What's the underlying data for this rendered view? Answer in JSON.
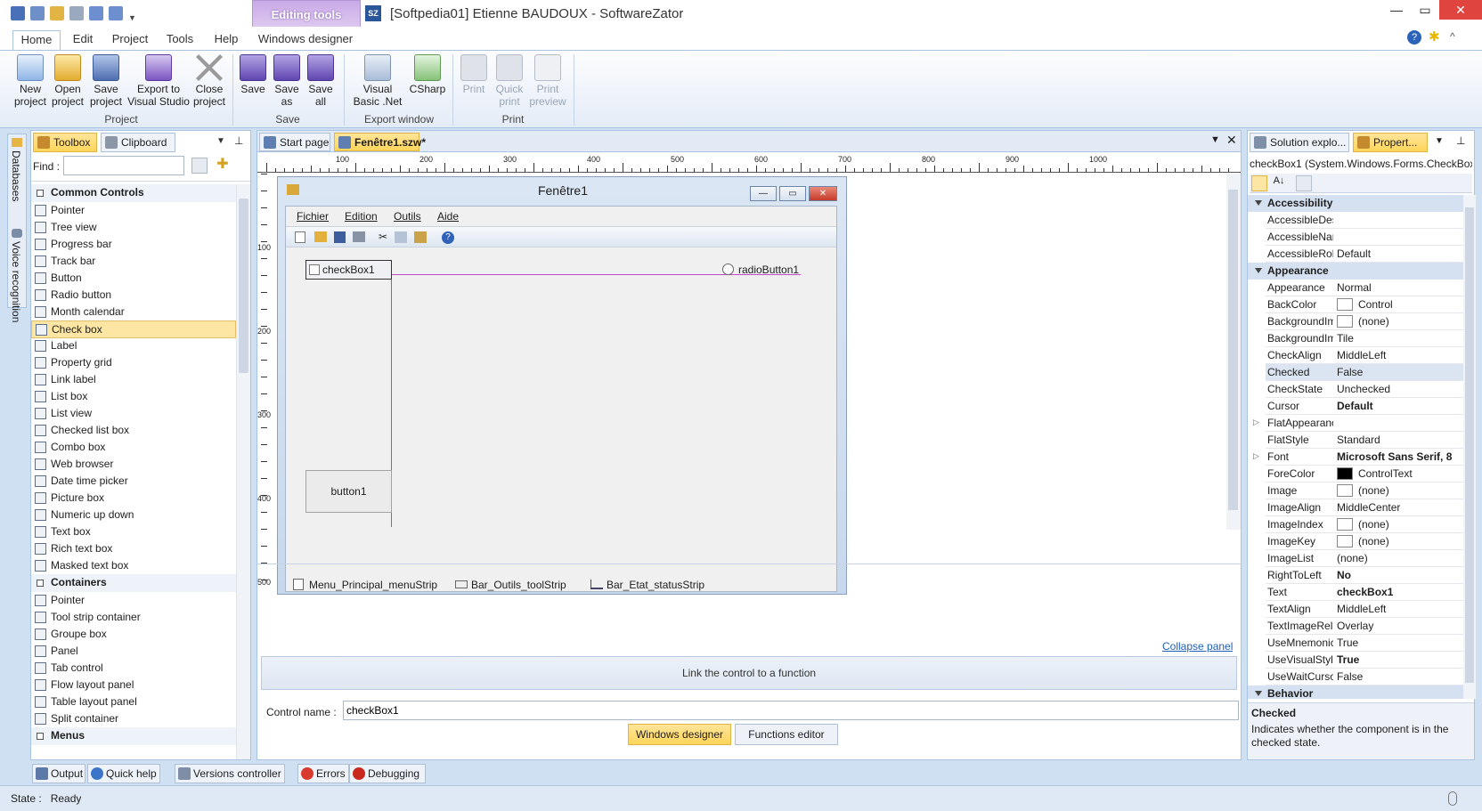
{
  "window": {
    "title": "[Softpedia01] Etienne BAUDOUX - SoftwareZator",
    "app_badge": "SZ",
    "context_tab": "Editing tools"
  },
  "menu_tabs": [
    "Home",
    "Edit",
    "Project",
    "Tools",
    "Help",
    "Windows designer"
  ],
  "ribbon": {
    "project": {
      "label": "Project",
      "buttons": [
        {
          "label": "New project"
        },
        {
          "label": "Open project"
        },
        {
          "label": "Save project"
        },
        {
          "label": "Export to Visual Studio"
        },
        {
          "label": "Close project"
        }
      ]
    },
    "save": {
      "label": "Save",
      "buttons": [
        {
          "label": "Save"
        },
        {
          "label": "Save as"
        },
        {
          "label": "Save all"
        }
      ]
    },
    "export": {
      "label": "Export window",
      "buttons": [
        {
          "label": "Visual Basic .Net"
        },
        {
          "label": "CSharp"
        }
      ]
    },
    "print": {
      "label": "Print",
      "buttons": [
        {
          "label": "Print"
        },
        {
          "label": "Quick print"
        },
        {
          "label": "Print preview"
        }
      ]
    }
  },
  "side_tabs": {
    "databases": "Databases",
    "voice": "Voice recognition"
  },
  "toolbox": {
    "tabs": [
      "Toolbox",
      "Clipboard"
    ],
    "find_label": "Find :",
    "find_value": "",
    "sections": [
      {
        "title": "Common Controls",
        "items": [
          "Pointer",
          "Tree view",
          "Progress bar",
          "Track bar",
          "Button",
          "Radio button",
          "Month calendar",
          "Check box",
          "Label",
          "Property grid",
          "Link label",
          "List box",
          "List view",
          "Checked list box",
          "Combo box",
          "Web browser",
          "Date time picker",
          "Picture box",
          "Numeric up down",
          "Text box",
          "Rich text box",
          "Masked text box"
        ]
      },
      {
        "title": "Containers",
        "items": [
          "Pointer",
          "Tool strip container",
          "Groupe box",
          "Panel",
          "Tab control",
          "Flow layout panel",
          "Table layout panel",
          "Split container"
        ]
      },
      {
        "title": "Menus",
        "items": []
      }
    ],
    "selected": "Check box"
  },
  "doc_tabs": [
    "Start page",
    "Fenêtre1.szw*"
  ],
  "ruler": {
    "h": [
      "100",
      "200",
      "300",
      "400",
      "500",
      "600",
      "700",
      "800",
      "900",
      "1000"
    ],
    "v": [
      "100",
      "200",
      "300",
      "400",
      "500"
    ]
  },
  "designed_form": {
    "title": "Fenêtre1",
    "menu": [
      "Fichier",
      "Edition",
      "Outils",
      "Aide"
    ],
    "checkbox": "checkBox1",
    "radio": "radioButton1",
    "button": "button1"
  },
  "components": [
    "Menu_Principal_menuStrip",
    "Bar_Outils_toolStrip",
    "Bar_Etat_statusStrip"
  ],
  "collapse_panel": "Collapse panel",
  "link_function": "Link the control to a function",
  "control_name_label": "Control name :",
  "control_name_value": "checkBox1",
  "designer_tabs": [
    "Windows designer",
    "Functions editor"
  ],
  "right_tabs": [
    "Solution explo...",
    "Propert..."
  ],
  "properties": {
    "object": "checkBox1 (System.Windows.Forms.CheckBox)",
    "rows": [
      {
        "cat": "Accessibility"
      },
      {
        "k": "AccessibleDescription",
        "v": ""
      },
      {
        "k": "AccessibleName",
        "v": ""
      },
      {
        "k": "AccessibleRole",
        "v": "Default"
      },
      {
        "cat": "Appearance"
      },
      {
        "k": "Appearance",
        "v": "Normal"
      },
      {
        "k": "BackColor",
        "v": "Control",
        "sw": "#ffffff"
      },
      {
        "k": "BackgroundImage",
        "v": "(none)",
        "sw": "#ffffff"
      },
      {
        "k": "BackgroundImageLayout",
        "v": "Tile"
      },
      {
        "k": "CheckAlign",
        "v": "MiddleLeft"
      },
      {
        "k": "Checked",
        "v": "False",
        "hl": true
      },
      {
        "k": "CheckState",
        "v": "Unchecked"
      },
      {
        "k": "Cursor",
        "v": "Default",
        "b": true
      },
      {
        "k": "FlatAppearance",
        "v": "",
        "exp": true
      },
      {
        "k": "FlatStyle",
        "v": "Standard"
      },
      {
        "k": "Font",
        "v": "Microsoft Sans Serif, 8",
        "b": true,
        "exp": true
      },
      {
        "k": "ForeColor",
        "v": "ControlText",
        "sw": "#000000"
      },
      {
        "k": "Image",
        "v": "(none)",
        "sw": "#ffffff"
      },
      {
        "k": "ImageAlign",
        "v": "MiddleCenter"
      },
      {
        "k": "ImageIndex",
        "v": "(none)",
        "sw": "#ffffff"
      },
      {
        "k": "ImageKey",
        "v": "(none)",
        "sw": "#ffffff"
      },
      {
        "k": "ImageList",
        "v": "(none)"
      },
      {
        "k": "RightToLeft",
        "v": "No",
        "b": true
      },
      {
        "k": "Text",
        "v": "checkBox1",
        "b": true
      },
      {
        "k": "TextAlign",
        "v": "MiddleLeft"
      },
      {
        "k": "TextImageRelation",
        "v": "Overlay"
      },
      {
        "k": "UseMnemonic",
        "v": "True"
      },
      {
        "k": "UseVisualStyleBackColor",
        "v": "True",
        "b": true
      },
      {
        "k": "UseWaitCursor",
        "v": "False"
      },
      {
        "cat": "Behavior"
      }
    ],
    "help_title": "Checked",
    "help_text": "Indicates whether the component is in the checked state."
  },
  "bottom_tabs": [
    "Output",
    "Quick help",
    "Versions controller",
    "Errors",
    "Debugging"
  ],
  "status": "State :   Ready",
  "colors": {
    "accent": "#2b579a",
    "selected": "#fde6a3",
    "title_purple": "#b197d6"
  }
}
